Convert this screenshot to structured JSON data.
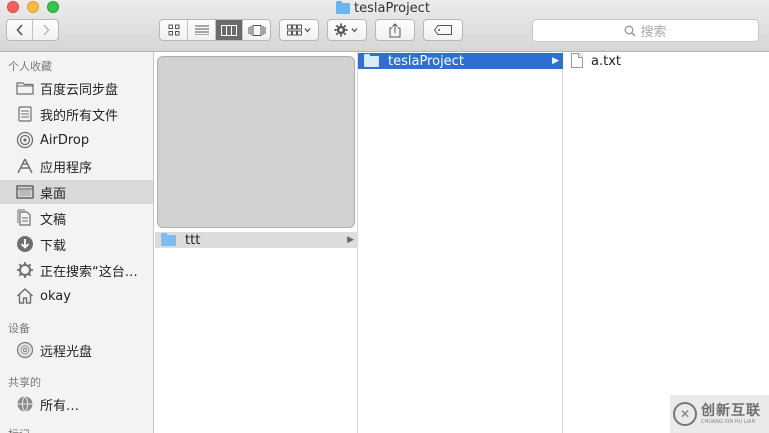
{
  "window": {
    "title": "teslaProject"
  },
  "toolbar": {
    "back_icon": "chevron-left-icon",
    "forward_icon": "chevron-right-icon",
    "views": [
      "icon-view",
      "list-view",
      "column-view",
      "coverflow-view"
    ],
    "active_view": "column-view",
    "arrange_icon": "arrange-grid-icon",
    "action_icon": "gear-icon",
    "share_icon": "share-icon",
    "tag_icon": "tag-icon",
    "search_placeholder": "搜索"
  },
  "sidebar": {
    "favorites_header": "个人收藏",
    "favorites": [
      {
        "label": "百度云同步盘",
        "icon": "folder-icon"
      },
      {
        "label": "我的所有文件",
        "icon": "all-files-icon"
      },
      {
        "label": "AirDrop",
        "icon": "airdrop-icon"
      },
      {
        "label": "应用程序",
        "icon": "applications-icon"
      },
      {
        "label": "桌面",
        "icon": "desktop-icon",
        "selected": true
      },
      {
        "label": "文稿",
        "icon": "documents-icon"
      },
      {
        "label": "下载",
        "icon": "download-icon"
      },
      {
        "label": "正在搜索“这台…",
        "icon": "gear-icon"
      },
      {
        "label": "okay",
        "icon": "home-icon"
      }
    ],
    "devices_header": "设备",
    "devices": [
      {
        "label": "远程光盘",
        "icon": "disc-icon"
      }
    ],
    "shared_header": "共享的",
    "shared": [
      {
        "label": "所有…",
        "icon": "network-icon"
      }
    ],
    "tags_header": "标记"
  },
  "columns": {
    "col1": {
      "items": [
        {
          "name": "ttt",
          "type": "folder"
        }
      ]
    },
    "col2": {
      "items": [
        {
          "name": "teslaProject",
          "type": "folder",
          "selected": true
        }
      ]
    },
    "col3": {
      "items": [
        {
          "name": "a.txt",
          "type": "file"
        }
      ]
    }
  },
  "watermark": {
    "text": "创新互联",
    "subtext": "CHUANG XIN HU LIAN"
  }
}
